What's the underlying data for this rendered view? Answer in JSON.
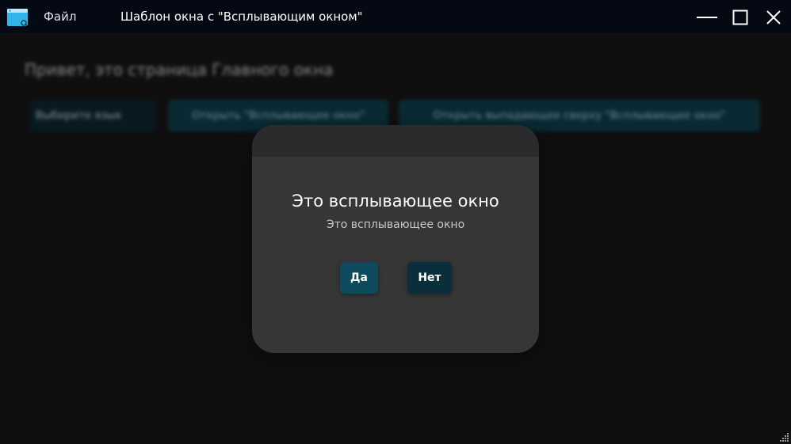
{
  "titlebar": {
    "menu_file": "Файл",
    "title": "Шаблон окна с \"Всплывающим окном\""
  },
  "main": {
    "heading": "Привет, это страница Главного окна",
    "language_select": "Выберите язык",
    "open_popup_button": "Открыть \"Всплывающее окно\"",
    "open_dropdown_button": "Открыть выпадающее сверху \"Всплывающее окно\""
  },
  "popup": {
    "title": "Это всплывающее окно",
    "message": "Это всплывающее окно",
    "yes_label": "Да",
    "no_label": "Нет"
  },
  "colors": {
    "titlebar_bg": "#040914",
    "window_bg": "#0f0f0f",
    "popup_bg": "#363636",
    "popup_header_bg": "#292b2c",
    "accent_yes": "#0e4a5e",
    "accent_no": "#0a2f3c",
    "app_icon": "#2fb5e8"
  },
  "icons": {
    "app": "window-icon",
    "minimize": "minimize-icon",
    "maximize": "maximize-icon",
    "close": "close-icon",
    "resize": "resize-grip-icon"
  }
}
